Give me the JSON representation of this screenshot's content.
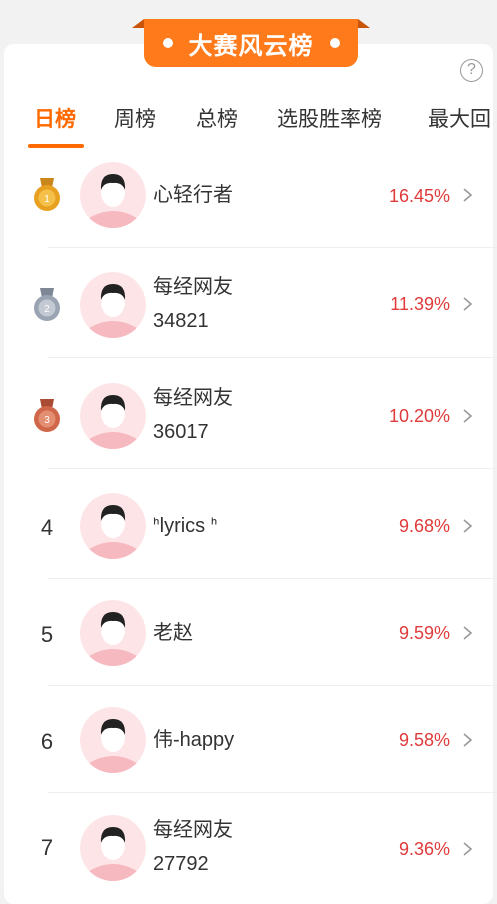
{
  "header": {
    "title": "大赛风云榜",
    "help_symbol": "?"
  },
  "tabs": [
    {
      "label": "日榜",
      "active": true
    },
    {
      "label": "周榜",
      "active": false
    },
    {
      "label": "总榜",
      "active": false
    },
    {
      "label": "选股胜率榜",
      "active": false
    },
    {
      "label": "最大回",
      "active": false
    }
  ],
  "colors": {
    "accent": "#ff6a00",
    "ribbon": "#ff7a1a",
    "rate": "#e03a3a",
    "gold": "#e8a020",
    "silver": "#9aa4b2",
    "bronze": "#d0674a"
  },
  "rankings": [
    {
      "rank": "1",
      "medal": "gold",
      "name_line1": "心轻行者",
      "name_line2": "",
      "rate": "16.45%"
    },
    {
      "rank": "2",
      "medal": "silver",
      "name_line1": "每经网友",
      "name_line2": "34821",
      "rate": "11.39%"
    },
    {
      "rank": "3",
      "medal": "bronze",
      "name_line1": "每经网友",
      "name_line2": "36017",
      "rate": "10.20%"
    },
    {
      "rank": "4",
      "medal": "",
      "name_line1": "ᑋlyrics ᑋ",
      "name_line2": "",
      "rate": "9.68%"
    },
    {
      "rank": "5",
      "medal": "",
      "name_line1": "老赵",
      "name_line2": "",
      "rate": "9.59%"
    },
    {
      "rank": "6",
      "medal": "",
      "name_line1": "伟-happy",
      "name_line2": "",
      "rate": "9.58%"
    },
    {
      "rank": "7",
      "medal": "",
      "name_line1": "每经网友",
      "name_line2": "27792",
      "rate": "9.36%"
    }
  ]
}
